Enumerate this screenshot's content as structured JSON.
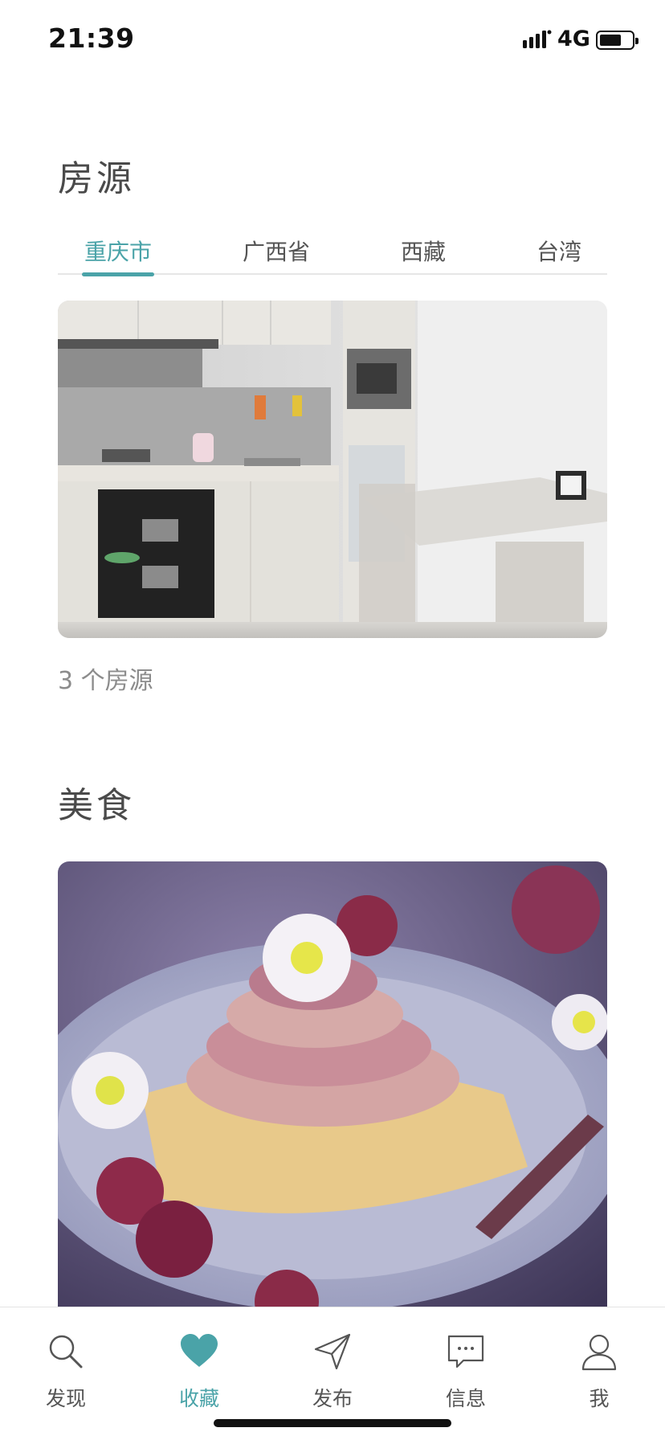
{
  "status_bar": {
    "time": "21:39",
    "network": "4G"
  },
  "sections": {
    "housing": {
      "title": "房源",
      "tabs": [
        {
          "label": "重庆市",
          "active": true
        },
        {
          "label": "广西省",
          "active": false
        },
        {
          "label": "西藏",
          "active": false
        },
        {
          "label": "台湾",
          "active": false
        }
      ],
      "count_text": "3 个房源",
      "image_icon": "kitchen-photo"
    },
    "food": {
      "title": "美食",
      "image_icon": "dessert-photo"
    }
  },
  "tabbar": {
    "items": [
      {
        "label": "发现",
        "icon": "search-icon",
        "active": false
      },
      {
        "label": "收藏",
        "icon": "heart-icon",
        "active": true
      },
      {
        "label": "发布",
        "icon": "send-icon",
        "active": false
      },
      {
        "label": "信息",
        "icon": "chat-icon",
        "active": false
      },
      {
        "label": "我",
        "icon": "user-icon",
        "active": false
      }
    ]
  },
  "colors": {
    "accent": "#4aa3a8",
    "title": "#4a4a4a",
    "muted": "#8c8c8c"
  }
}
